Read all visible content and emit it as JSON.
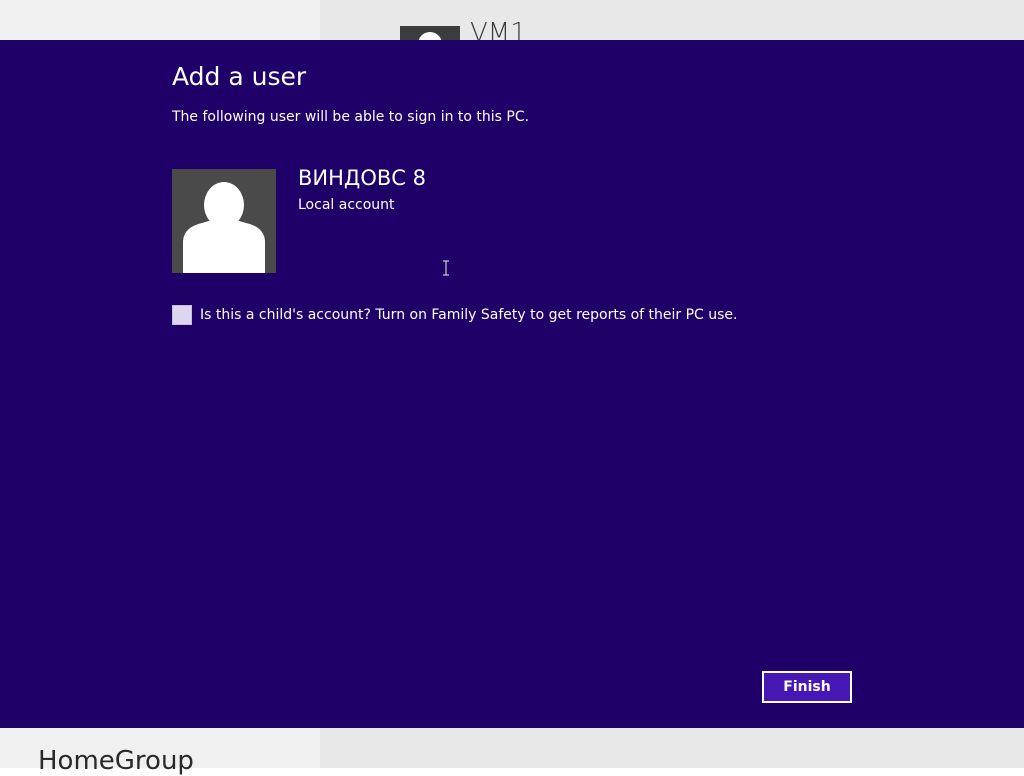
{
  "background": {
    "vm_name": "VM1",
    "homegroup_label": "HomeGroup"
  },
  "dialog": {
    "title": "Add a user",
    "subtitle": "The following user will be able to sign in to this PC.",
    "user": {
      "name": "ВИНДОВС 8",
      "account_type": "Local account",
      "avatar_icon": "user-silhouette-icon"
    },
    "child_account": {
      "checked": false,
      "label": "Is this a child's account? Turn on Family Safety to get reports of their PC use."
    },
    "finish_label": "Finish"
  },
  "colors": {
    "dialog_background": "#1e0068",
    "button_background": "#4617b4",
    "text": "#ffffff"
  }
}
